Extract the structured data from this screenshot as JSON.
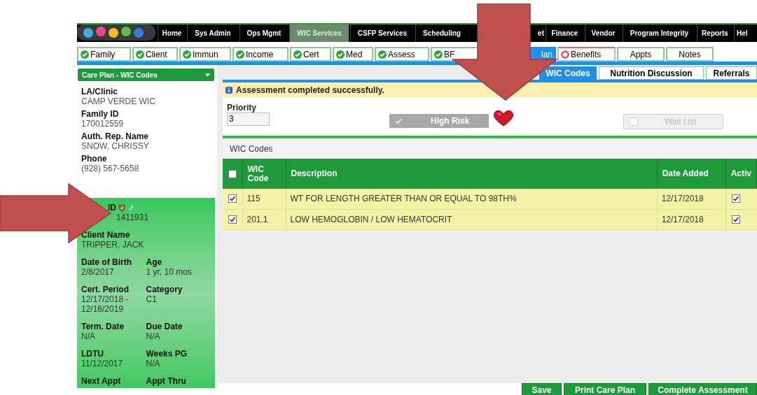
{
  "nav": {
    "items": [
      {
        "label": "Home",
        "selected": false,
        "kind": "full"
      },
      {
        "label": "Sys Admin",
        "selected": false,
        "kind": "full"
      },
      {
        "label": "Ops Mgmt",
        "selected": false,
        "kind": "full"
      },
      {
        "label": "WIC Services",
        "selected": true,
        "kind": "full"
      },
      {
        "label": "CSFP Services",
        "selected": false,
        "kind": "full"
      },
      {
        "label": "Scheduling",
        "selected": false,
        "kind": "full"
      },
      {
        "label": "et",
        "selected": false,
        "kind": "cut_left"
      },
      {
        "label": "Finance",
        "selected": false,
        "kind": "full"
      },
      {
        "label": "Vendor",
        "selected": false,
        "kind": "full"
      },
      {
        "label": "Program Integrity",
        "selected": false,
        "kind": "full"
      },
      {
        "label": "Reports",
        "selected": false,
        "kind": "full"
      },
      {
        "label": "Hel",
        "selected": false,
        "kind": "cut_right"
      }
    ]
  },
  "step_tabs": [
    {
      "label": "Family",
      "kind": "complete",
      "selected": false
    },
    {
      "label": "Client",
      "kind": "complete",
      "selected": false
    },
    {
      "label": "Immun",
      "kind": "complete",
      "selected": false
    },
    {
      "label": "Income",
      "kind": "complete",
      "selected": false
    },
    {
      "label": "Cert",
      "kind": "complete",
      "selected": false
    },
    {
      "label": "Med",
      "kind": "complete",
      "selected": false
    },
    {
      "label": "Assess",
      "kind": "complete",
      "selected": false
    },
    {
      "label": "BF",
      "kind": "complete",
      "selected": false
    },
    {
      "label": "lan",
      "kind": "plain",
      "selected": true
    },
    {
      "label": "Benefits",
      "kind": "incomplete",
      "selected": false
    },
    {
      "label": "Appts",
      "kind": "plain",
      "selected": false
    },
    {
      "label": "Notes",
      "kind": "plain",
      "selected": false
    }
  ],
  "sidebar": {
    "dropdown": "Care Plan - WIC Codes",
    "info": [
      [
        {
          "label": "LA/Clinic",
          "value": "CAMP VERDE WIC"
        }
      ],
      [
        {
          "label": "Family ID",
          "value": "170012559"
        }
      ],
      [
        {
          "label": "Auth. Rep. Name",
          "value": "SNOW, CHRISSY"
        }
      ],
      [
        {
          "label": "Phone",
          "value": "(928) 567-5658"
        }
      ]
    ],
    "client": [
      [
        {
          "label": "ID",
          "value": "1411931",
          "kind": "cut_left"
        }
      ],
      [
        {
          "label": "Client Name",
          "value": "TRIPPER, JACK",
          "kind": "full"
        }
      ],
      [
        {
          "label": "Date of Birth",
          "value": "2/8/2017",
          "kind": "full"
        },
        {
          "label": "Age",
          "value": "1 yr, 10 mos",
          "kind": "full"
        }
      ],
      [
        {
          "label": "Cert. Period",
          "value": "12/17/2018 -\n12/16/2019",
          "kind": "full"
        },
        {
          "label": "Category",
          "value": "C1",
          "kind": "full"
        }
      ],
      [
        {
          "label": "Term. Date",
          "value": "N/A",
          "kind": "full"
        },
        {
          "label": "Due Date",
          "value": "N/A",
          "kind": "full"
        }
      ],
      [
        {
          "label": "LDTU",
          "value": "11/12/2017",
          "kind": "full"
        },
        {
          "label": "Weeks PG",
          "value": "N/A",
          "kind": "full"
        }
      ],
      [
        {
          "label": "Next Appt",
          "kind": "full"
        },
        {
          "label": "Appt Thru",
          "kind": "full"
        }
      ]
    ]
  },
  "page_tabs": [
    {
      "label": "WIC Codes",
      "selected": true
    },
    {
      "label": "Nutrition Discussion",
      "selected": false
    },
    {
      "label": "Referrals",
      "selected": false
    }
  ],
  "message": "Assessment completed successfully.",
  "priority": {
    "label": "Priority",
    "value": "3"
  },
  "high_risk": {
    "label": "High Risk",
    "checked": true,
    "disabled": false
  },
  "wait_list": {
    "label": "Wait List",
    "checked": false,
    "disabled": true
  },
  "panel_title": "WIC Codes",
  "table": {
    "header_checked": false,
    "columns": [
      "WIC Code",
      "Description",
      "Date Added",
      "Activ"
    ],
    "rows": [
      {
        "selected": true,
        "code": "115",
        "description": "WT FOR LENGTH GREATER THAN OR EQUAL TO 98TH%",
        "date_added": "12/17/2018",
        "active": true
      },
      {
        "selected": true,
        "code": "201.1",
        "description": "LOW HEMOGLOBIN / LOW HEMATOCRIT",
        "date_added": "12/17/2018",
        "active": true
      }
    ]
  },
  "buttons": [
    "Save",
    "Print Care Plan",
    "Complete Assessment"
  ]
}
